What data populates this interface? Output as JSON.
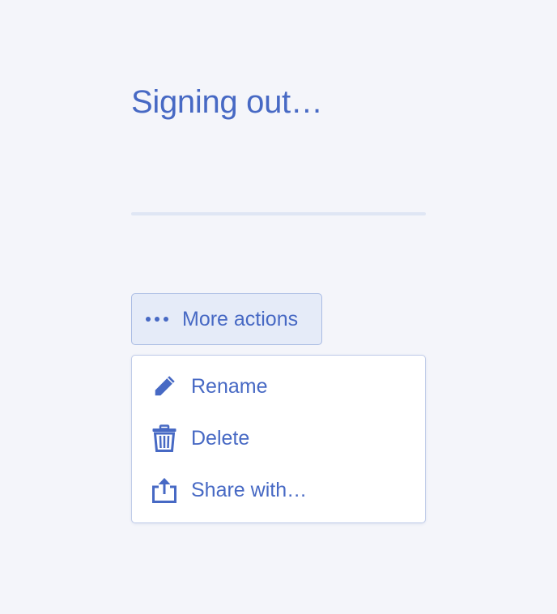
{
  "status": {
    "title": "Signing out…",
    "progress": 0
  },
  "actions": {
    "button_label": "More actions",
    "menu": [
      {
        "label": "Rename",
        "icon": "pencil-icon"
      },
      {
        "label": "Delete",
        "icon": "trash-icon"
      },
      {
        "label": "Share with…",
        "icon": "share-icon"
      }
    ]
  },
  "colors": {
    "background": "#f4f5fa",
    "accent": "#4769c4",
    "track": "#dfe6f4",
    "button_bg": "#e5ebf8",
    "button_border": "#a9bbe3"
  }
}
